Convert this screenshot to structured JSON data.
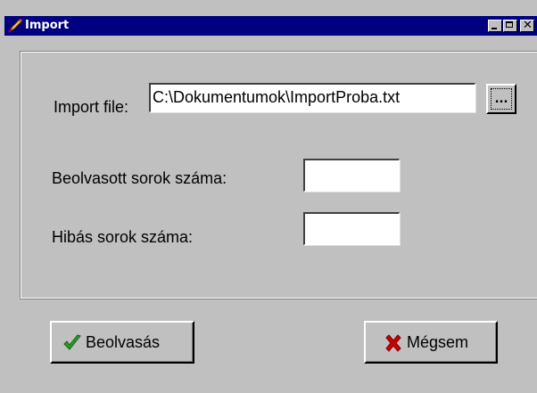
{
  "window": {
    "title": "Import",
    "icon": "app-quill-icon",
    "controls": {
      "minimize_icon": "minimize-icon",
      "maximize_icon": "maximize-icon",
      "close_icon": "close-icon",
      "close_glyph": "✕"
    }
  },
  "form": {
    "import_file_label": "Import file:",
    "import_file_value": "C:\\Dokumentumok\\ImportProba.txt",
    "browse_label": "...",
    "read_rows_label": "Beolvasott sorok száma:",
    "read_rows_value": "",
    "error_rows_label": "Hibás sorok száma:",
    "error_rows_value": ""
  },
  "actions": {
    "ok_label": "Beolvasás",
    "ok_icon": "checkmark-icon",
    "cancel_label": "Mégsem",
    "cancel_icon": "cross-icon"
  },
  "colors": {
    "titlebar": "#000080",
    "window_face": "#c0c0c0",
    "check_green": "#2e9a2e",
    "cross_red": "#cc0000"
  }
}
